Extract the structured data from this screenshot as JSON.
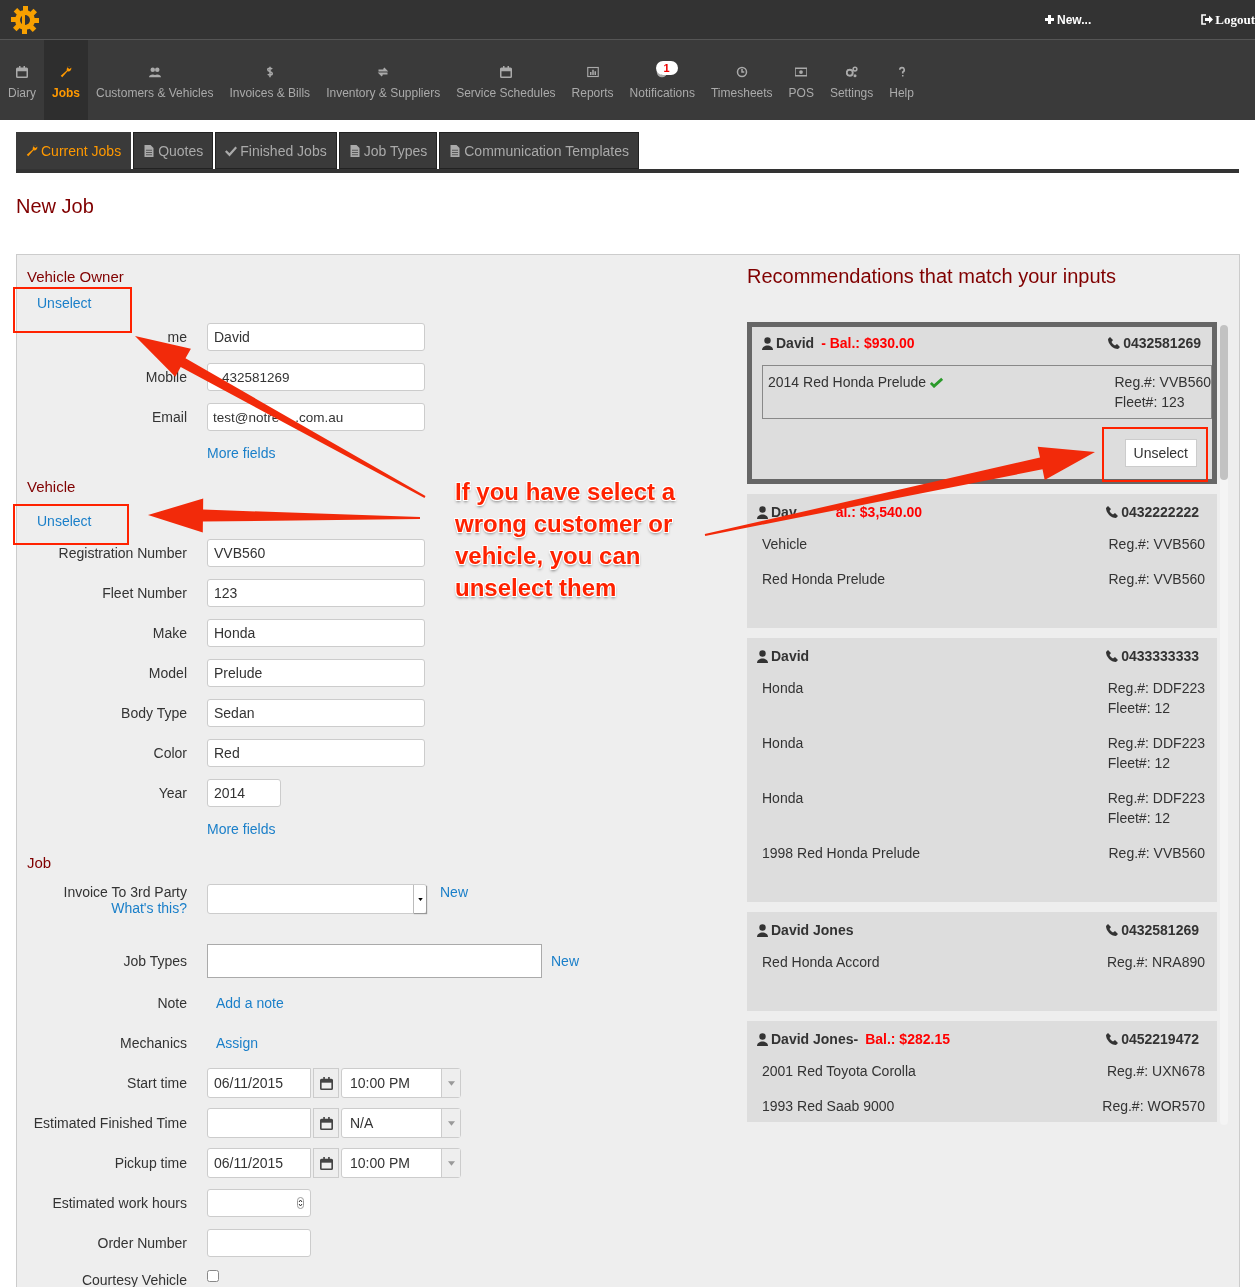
{
  "top_bar": {
    "new_label": "New...",
    "logout_label": "Logout"
  },
  "nav": [
    {
      "label": "Diary",
      "selected": false
    },
    {
      "label": "Jobs",
      "selected": true
    },
    {
      "label": "Customers & Vehicles",
      "selected": false
    },
    {
      "label": "Invoices & Bills",
      "selected": false
    },
    {
      "label": "Inventory & Suppliers",
      "selected": false
    },
    {
      "label": "Service Schedules",
      "selected": false
    },
    {
      "label": "Reports",
      "selected": false
    },
    {
      "label": "Notifications",
      "selected": false,
      "badge": "1"
    },
    {
      "label": "Timesheets",
      "selected": false
    },
    {
      "label": "POS",
      "selected": false
    },
    {
      "label": "Settings",
      "selected": false
    },
    {
      "label": "Help",
      "selected": false
    }
  ],
  "subtabs": [
    {
      "label": "Current Jobs",
      "selected": true
    },
    {
      "label": "Quotes",
      "selected": false
    },
    {
      "label": "Finished Jobs",
      "selected": false
    },
    {
      "label": "Job Types",
      "selected": false
    },
    {
      "label": "Communication Templates",
      "selected": false
    }
  ],
  "page_title": "New Job",
  "form": {
    "sections": [
      {
        "title": "Vehicle Owner",
        "unselect": "Unselect",
        "rows": [
          {
            "kind": "text",
            "label": "me",
            "value": "David"
          },
          {
            "kind": "obscured",
            "label": "Mobile",
            "after": "432581269"
          },
          {
            "kind": "obscured",
            "label": "Email",
            "before": "test@notre",
            "after": ".com.au"
          },
          {
            "kind": "link",
            "value": "More fields"
          }
        ]
      },
      {
        "title": "Vehicle",
        "unselect": "Unselect",
        "rows": [
          {
            "kind": "text",
            "label": "Registration Number",
            "value": "VVB560"
          },
          {
            "kind": "text",
            "label": "Fleet Number",
            "value": "123"
          },
          {
            "kind": "text",
            "label": "Make",
            "value": "Honda"
          },
          {
            "kind": "text",
            "label": "Model",
            "value": "Prelude"
          },
          {
            "kind": "text",
            "label": "Body Type",
            "value": "Sedan"
          },
          {
            "kind": "text",
            "label": "Color",
            "value": "Red"
          },
          {
            "kind": "short",
            "label": "Year",
            "value": "2014"
          },
          {
            "kind": "link",
            "value": "More fields"
          }
        ]
      },
      {
        "title": "Job",
        "rows": [
          {
            "kind": "select",
            "label": "Invoice To 3rd Party",
            "help": "What's this?",
            "action": "New"
          },
          {
            "kind": "wide",
            "label": "Job Types",
            "action": "New"
          },
          {
            "kind": "action",
            "label": "Note",
            "value": "Add a note"
          },
          {
            "kind": "action",
            "label": "Mechanics",
            "value": "Assign"
          },
          {
            "kind": "datetime",
            "label": "Start time",
            "date": "06/11/2015",
            "time": "10:00 PM"
          },
          {
            "kind": "datetime",
            "label": "Estimated Finished Time",
            "time": "N/A"
          },
          {
            "kind": "datetime",
            "label": "Pickup time",
            "date": "06/11/2015",
            "time": "10:00 PM"
          },
          {
            "kind": "number",
            "label": "Estimated work hours"
          },
          {
            "kind": "small",
            "label": "Order Number"
          },
          {
            "kind": "checkbox",
            "label": "Courtesy Vehicle",
            "checked": false
          }
        ]
      }
    ]
  },
  "recommendations": {
    "title": "Recommendations that match your inputs",
    "cards": [
      {
        "name": "David",
        "balance": "- Bal.: $930.00",
        "phone": "0432581269",
        "selected": true,
        "button": "Unselect",
        "vehicles": [
          {
            "description": "2014 Red Honda Prelude",
            "matched": true,
            "details": [
              "Reg.#: VVB560",
              "Fleet#: 123"
            ]
          }
        ]
      },
      {
        "name": "Dav",
        "balance": "al.: $3,540.00",
        "obscured": true,
        "phone": "0432222222",
        "selected": false,
        "vehicles": [
          {
            "description": "Vehicle",
            "matched": false,
            "details": [
              "Reg.#: VVB560"
            ]
          },
          {
            "description": "Red Honda Prelude",
            "matched": false,
            "details": [
              "Reg.#: VVB560"
            ]
          }
        ]
      },
      {
        "name": "David",
        "phone": "0433333333",
        "selected": false,
        "vehicles": [
          {
            "description": "Honda",
            "matched": false,
            "details": [
              "Reg.#: DDF223",
              "Fleet#: 12"
            ]
          },
          {
            "description": "Honda",
            "matched": false,
            "details": [
              "Reg.#: DDF223",
              "Fleet#: 12"
            ]
          },
          {
            "description": "Honda",
            "matched": false,
            "details": [
              "Reg.#: DDF223",
              "Fleet#: 12"
            ]
          },
          {
            "description": "1998 Red Honda Prelude",
            "matched": false,
            "details": [
              "Reg.#: VVB560"
            ]
          }
        ]
      },
      {
        "name": "David Jones",
        "phone": "0432581269",
        "selected": false,
        "vehicles": [
          {
            "description": "Red Honda Accord",
            "matched": false,
            "details": [
              "Reg.#: NRA890"
            ]
          }
        ]
      },
      {
        "name": "David Jones-",
        "balance": "Bal.: $282.15",
        "phone": "0452219472",
        "selected": false,
        "vehicles": [
          {
            "description": "2001 Red Toyota Corolla",
            "matched": false,
            "details": [
              "Reg.#: UXN678"
            ]
          },
          {
            "description": "1993 Red Saab 9000",
            "matched": false,
            "details": [
              "Reg.#: WOR570"
            ]
          }
        ]
      }
    ]
  },
  "annotation": {
    "callout": "If you have select a wrong customer or vehicle, you can unselect them"
  }
}
